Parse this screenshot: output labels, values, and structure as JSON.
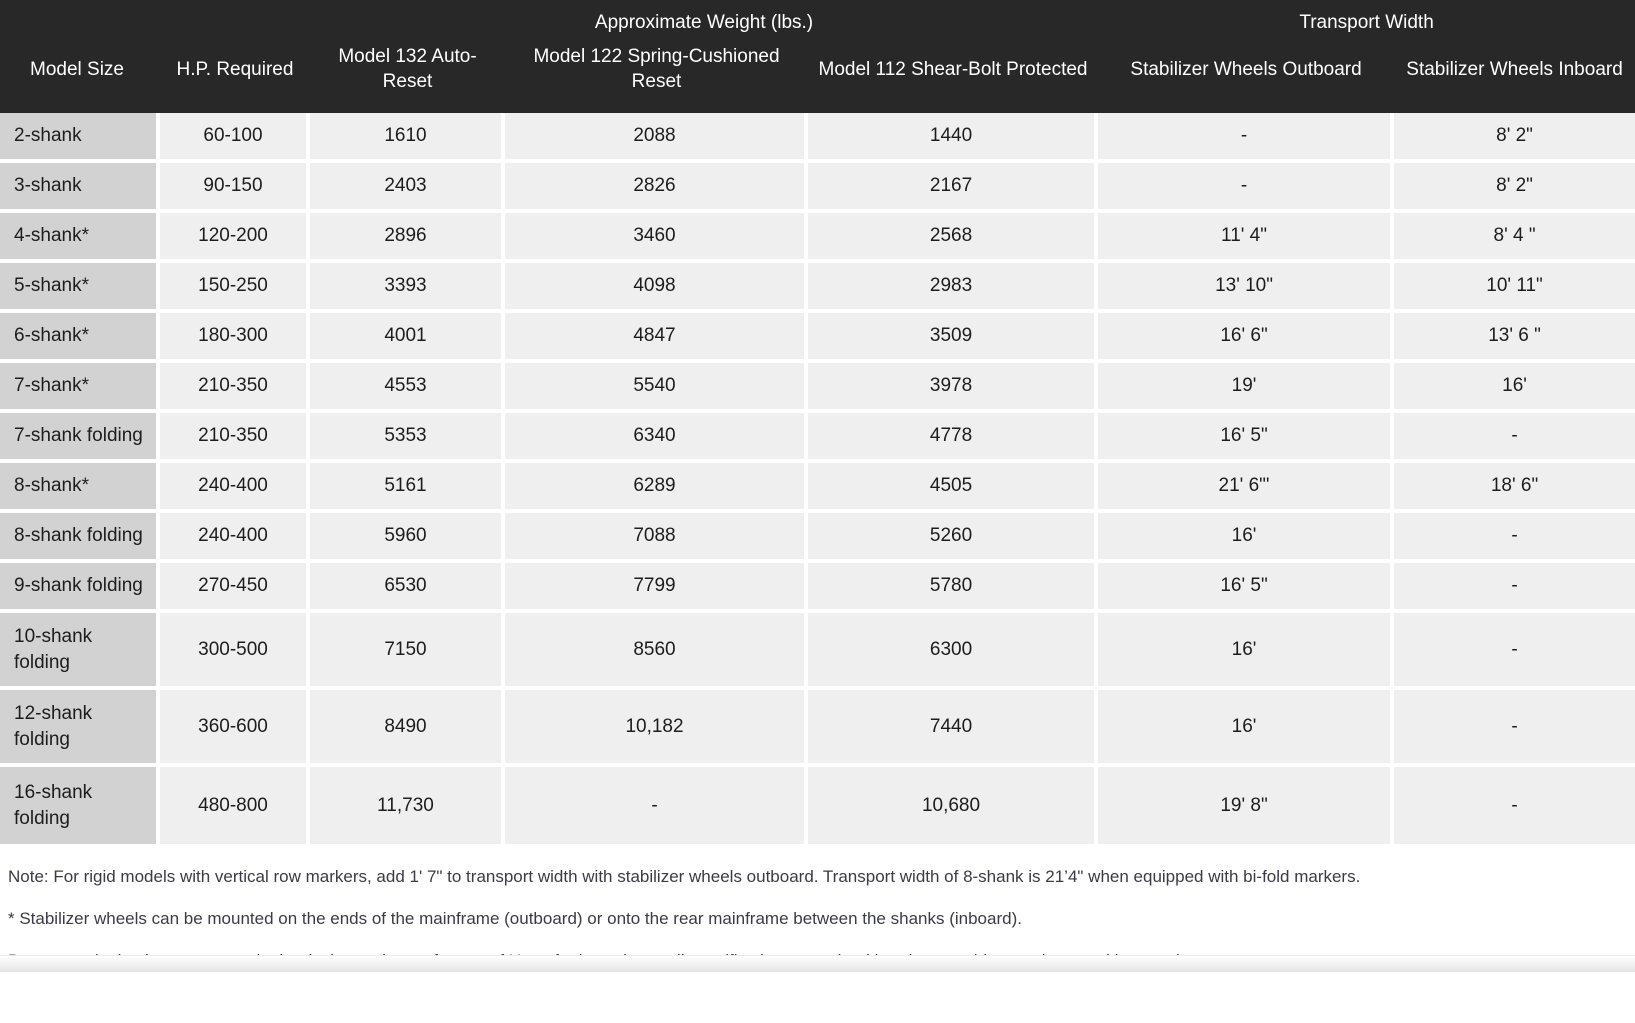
{
  "table": {
    "group_headers": [
      {
        "label": "",
        "span": 2
      },
      {
        "label": "Approximate Weight (lbs.)",
        "span": 3
      },
      {
        "label": "Transport Width",
        "span": 2
      }
    ],
    "columns": [
      "Model Size",
      "H.P. Required",
      "Model 132 Auto-Reset",
      "Model 122 Spring-Cushioned Reset",
      "Model 112 Shear-Bolt Protected",
      "Stabilizer Wheels Outboard",
      "Stabilizer Wheels Inboard"
    ],
    "rows": [
      {
        "model": "2-shank",
        "hp": "60-100",
        "m132": "1610",
        "m122": "2088",
        "m112": "1440",
        "outboard": "-",
        "inboard": "8' 2\"",
        "tall": false
      },
      {
        "model": "3-shank",
        "hp": "90-150",
        "m132": "2403",
        "m122": "2826",
        "m112": "2167",
        "outboard": "-",
        "inboard": "8' 2\"",
        "tall": false
      },
      {
        "model": "4-shank*",
        "hp": "120-200",
        "m132": "2896",
        "m122": "3460",
        "m112": "2568",
        "outboard": "11' 4\"",
        "inboard": "8' 4 \"",
        "tall": false
      },
      {
        "model": "5-shank*",
        "hp": "150-250",
        "m132": "3393",
        "m122": "4098",
        "m112": "2983",
        "outboard": "13' 10\"",
        "inboard": "10' 11\"",
        "tall": false
      },
      {
        "model": "6-shank*",
        "hp": "180-300",
        "m132": "4001",
        "m122": "4847",
        "m112": "3509",
        "outboard": "16' 6\"",
        "inboard": "13' 6 \"",
        "tall": false
      },
      {
        "model": "7-shank*",
        "hp": "210-350",
        "m132": "4553",
        "m122": "5540",
        "m112": "3978",
        "outboard": "19'",
        "inboard": "16'",
        "tall": false
      },
      {
        "model": "7-shank folding",
        "hp": "210-350",
        "m132": "5353",
        "m122": "6340",
        "m112": "4778",
        "outboard": "16' 5\"",
        "inboard": "-",
        "tall": false
      },
      {
        "model": "8-shank*",
        "hp": "240-400",
        "m132": "5161",
        "m122": "6289",
        "m112": "4505",
        "outboard": "21' 6\"'",
        "inboard": "18' 6\"",
        "tall": false
      },
      {
        "model": "8-shank folding",
        "hp": "240-400",
        "m132": "5960",
        "m122": "7088",
        "m112": "5260",
        "outboard": "16'",
        "inboard": "-",
        "tall": false
      },
      {
        "model": "9-shank folding",
        "hp": "270-450",
        "m132": "6530",
        "m122": "7799",
        "m112": "5780",
        "outboard": "16' 5\"",
        "inboard": "-",
        "tall": false
      },
      {
        "model": "10-shank folding",
        "hp": "300-500",
        "m132": "7150",
        "m122": "8560",
        "m112": "6300",
        "outboard": "16'",
        "inboard": "-",
        "tall": true
      },
      {
        "model": "12-shank folding",
        "hp": "360-600",
        "m132": "8490",
        "m122": "10,182",
        "m112": "7440",
        "outboard": "16'",
        "inboard": "-",
        "tall": true
      },
      {
        "model": "16-shank folding",
        "hp": "480-800",
        "m132": "11,730",
        "m122": "-",
        "m112": "10,680",
        "outboard": "19' 8\"",
        "inboard": "-",
        "tall": true
      }
    ]
  },
  "notes": [
    "Note: For rigid models with vertical row markers, add 1' 7\" to  transport width with stabilizer wheels outboard. Transport width of 8-shank is 21’4\" when equipped with bi-fold markers.",
    "* Stabilizer wheels can be mounted on the ends of the mainframe (outboard) or onto the rear mainframe between the shanks (inboard).",
    "Due to continuing improvements in the design and manufacture of Unverferth products, all specifications contained herein are subject to change without notice."
  ],
  "colors": {
    "header_bg": "#282828",
    "header_text": "#ffffff",
    "row_label_bg": "#d2d2d2",
    "cell_bg": "#efefef",
    "cell_text": "#1d1d1d",
    "note_text": "#3b3b46",
    "page_bg": "#ffffff"
  }
}
